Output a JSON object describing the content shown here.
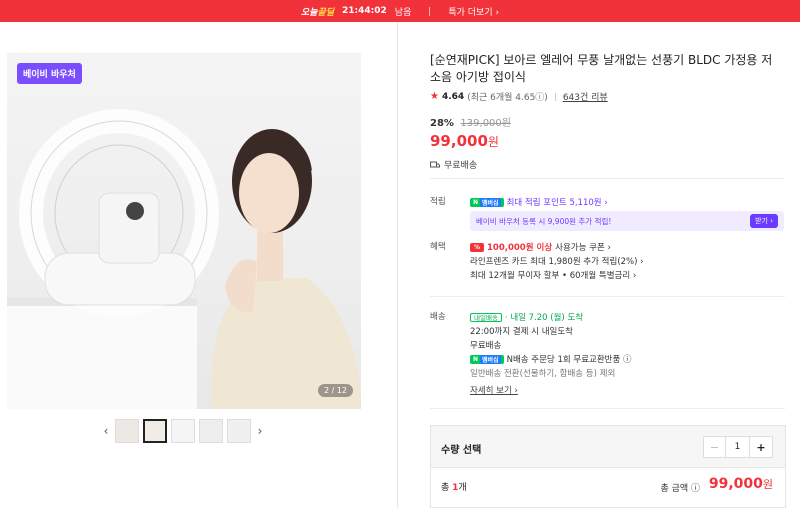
{
  "banner": {
    "deal_label_1": "오늘",
    "deal_label_2": "끝딜",
    "time": "21:44:02",
    "time_suffix": "남음",
    "more": "특가 더보기 ›"
  },
  "gallery": {
    "badge": "베이비 바우처",
    "counter": "2 / 12",
    "prev": "‹",
    "next": "›"
  },
  "product": {
    "title": "[순연재PICK] 보아르 엘레어 무풍 날개없는 선풍기 BLDC 가정용 저소음 아기방 접이식",
    "rating": "4.64",
    "rating_recent": "(최근 6개월 4.65ⓘ)",
    "reviews": "643건 리뷰",
    "discount": "28%",
    "original_price": "139,000원",
    "price": "99,000",
    "price_unit": "원",
    "shipping_free": "무료배송"
  },
  "points": {
    "label": "적립",
    "npay": "N",
    "npay_plus": "멤버십",
    "max_points": "최대 적립 포인트 5,110원 ›",
    "voucher_text": "베이비 바우처 등록 시 9,900원 추가 적립!",
    "voucher_btn": "받기 ›"
  },
  "benefits": {
    "label": "혜택",
    "coupon_tag": "%",
    "coupon_amount": "100,000원 이상",
    "coupon_text": "사용가능 쿠폰 ›",
    "card": "라인프렌즈 카드 최대 1,980원 추가 적립(2%) ›",
    "installment": "최대 12개월 무이자 할부 • 60개월 특별금리 ›"
  },
  "delivery": {
    "label": "배송",
    "tag": "내일배송",
    "eta": "· 내일 7.20 (월) 도착",
    "cutoff": "22:00까지 결제 시 내일도착",
    "free": "무료배송",
    "npay": "N",
    "npay_plus": "멤버십",
    "return": "N배송 주문당 1회 무료교환반품 ⓘ",
    "exclude": "일반배송 전환(선물하기, 합배송 등) 제외",
    "detail": "자세히 보기 ›"
  },
  "order": {
    "qty_title": "수량 선택",
    "minus": "−",
    "qty": "1",
    "plus": "+",
    "total_count_prefix": "총 ",
    "total_count": "1",
    "total_count_suffix": "개",
    "total_label": "총 금액 ⓘ",
    "total_price": "99,000",
    "total_unit": "원"
  },
  "colors": {
    "accent": "#f2323a",
    "membership": "#6b3bff",
    "npay_green": "#03c75a"
  }
}
